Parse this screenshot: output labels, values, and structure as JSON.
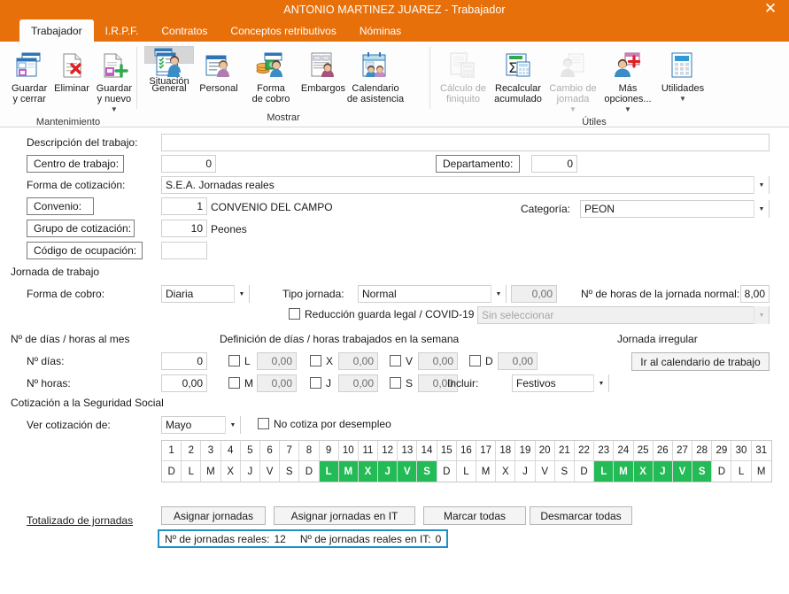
{
  "window": {
    "title": "ANTONIO MARTINEZ JUAREZ - Trabajador",
    "close_icon": "close-icon"
  },
  "tabs": [
    {
      "label": "Trabajador",
      "active": true
    },
    {
      "label": "I.R.P.F.",
      "active": false
    },
    {
      "label": "Contratos",
      "active": false
    },
    {
      "label": "Conceptos retributivos",
      "active": false
    },
    {
      "label": "Nóminas",
      "active": false
    }
  ],
  "ribbon": {
    "groups": [
      {
        "title": "Mantenimiento",
        "buttons": [
          {
            "label": "Guardar\ny cerrar",
            "icon": "save-close-icon",
            "disabled": false,
            "selected": false,
            "caret": false
          },
          {
            "label": "Eliminar",
            "icon": "delete-icon",
            "disabled": false,
            "selected": false,
            "caret": false
          },
          {
            "label": "Guardar\ny nuevo",
            "icon": "save-new-icon",
            "disabled": false,
            "selected": false,
            "caret": true
          }
        ]
      },
      {
        "title": "Mostrar",
        "buttons": [
          {
            "label": "General",
            "icon": "general-person-icon",
            "disabled": false,
            "selected": false,
            "caret": false
          },
          {
            "label": "Personal",
            "icon": "personal-icon",
            "disabled": false,
            "selected": false,
            "caret": false
          },
          {
            "label": "Situación",
            "icon": "situacion-icon",
            "disabled": false,
            "selected": true,
            "caret": false
          },
          {
            "label": "Forma\nde cobro",
            "icon": "forma-cobro-money-icon",
            "disabled": false,
            "selected": false,
            "caret": false
          },
          {
            "label": "Embargos",
            "icon": "embargos-icon",
            "disabled": false,
            "selected": false,
            "caret": false
          },
          {
            "label": "Calendario\nde asistencia",
            "icon": "calendar-asistencia-icon",
            "disabled": false,
            "selected": false,
            "caret": false
          }
        ]
      },
      {
        "title": "Útiles",
        "buttons": [
          {
            "label": "Cálculo de\nfiniquito",
            "icon": "calculo-finiquito-icon",
            "disabled": true,
            "selected": false,
            "caret": false
          },
          {
            "label": "Recalcular\nacumulado",
            "icon": "recalcular-sigma-icon",
            "disabled": false,
            "selected": false,
            "caret": false
          },
          {
            "label": "Cambio de\njornada",
            "icon": "cambio-jornada-icon",
            "disabled": true,
            "selected": false,
            "caret": true
          },
          {
            "label": "Más\nopciones...",
            "icon": "mas-opciones-icon",
            "disabled": false,
            "selected": false,
            "caret": true
          },
          {
            "label": "Utilidades",
            "icon": "utilidades-calculator-icon",
            "disabled": false,
            "selected": false,
            "caret": true
          }
        ]
      }
    ]
  },
  "form": {
    "descripcion_label": "Descripción del trabajo:",
    "descripcion_value": "",
    "centro_label": "Centro de trabajo:",
    "centro_value": "0",
    "departamento_label": "Departamento:",
    "departamento_value": "0",
    "forma_cotizacion_label": "Forma de cotización:",
    "forma_cotizacion_value": "S.E.A. Jornadas reales",
    "convenio_label": "Convenio:",
    "convenio_code": "1",
    "convenio_name": "CONVENIO DEL CAMPO",
    "categoria_label": "Categoría:",
    "categoria_value": "PEON",
    "grupo_label": "Grupo de cotización:",
    "grupo_code": "10",
    "grupo_name": "Peones",
    "codigo_ocupacion_label": "Código de ocupación:",
    "codigo_ocupacion_value": ""
  },
  "jornada": {
    "section_title": "Jornada de trabajo",
    "forma_cobro_label": "Forma de cobro:",
    "forma_cobro_value": "Diaria",
    "tipo_jornada_label": "Tipo jornada:",
    "tipo_jornada_value": "Normal",
    "tipo_jornada_num": "0,00",
    "horas_label": "Nº de horas de la jornada normal:",
    "horas_value": "8,00",
    "reduccion_label": "Reducción guarda legal / COVID-19",
    "reduccion_checked": false,
    "reduccion_value": "Sin seleccionar"
  },
  "dias_mes": {
    "section_title": "Nº de días / horas al mes",
    "dias_label": "Nº días:",
    "dias_value": "0",
    "horas_label": "Nº horas:",
    "horas_value": "0,00"
  },
  "semana": {
    "section_title": "Definición de días / horas trabajados en la semana",
    "days": [
      {
        "code": "L",
        "value": "0,00",
        "checked": false
      },
      {
        "code": "M",
        "value": "0,00",
        "checked": false
      },
      {
        "code": "X",
        "value": "0,00",
        "checked": false
      },
      {
        "code": "J",
        "value": "0,00",
        "checked": false
      },
      {
        "code": "V",
        "value": "0,00",
        "checked": false
      },
      {
        "code": "S",
        "value": "0,00",
        "checked": false
      },
      {
        "code": "D",
        "value": "0,00",
        "checked": false
      }
    ],
    "incluir_label": "Incluir:",
    "incluir_value": "Festivos"
  },
  "irregular": {
    "section_title": "Jornada irregular",
    "button_label": "Ir al calendario de trabajo"
  },
  "cotizacion": {
    "section_title": "Cotización a la Seguridad Social",
    "ver_label": "Ver cotización de:",
    "ver_value": "Mayo",
    "no_cotiza_label": "No cotiza por desempleo",
    "no_cotiza_checked": false
  },
  "calendar": {
    "days": [
      {
        "num": "1",
        "letter": "D",
        "on": false
      },
      {
        "num": "2",
        "letter": "L",
        "on": false
      },
      {
        "num": "3",
        "letter": "M",
        "on": false
      },
      {
        "num": "4",
        "letter": "X",
        "on": false
      },
      {
        "num": "5",
        "letter": "J",
        "on": false
      },
      {
        "num": "6",
        "letter": "V",
        "on": false
      },
      {
        "num": "7",
        "letter": "S",
        "on": false
      },
      {
        "num": "8",
        "letter": "D",
        "on": false
      },
      {
        "num": "9",
        "letter": "L",
        "on": true
      },
      {
        "num": "10",
        "letter": "M",
        "on": true
      },
      {
        "num": "11",
        "letter": "X",
        "on": true
      },
      {
        "num": "12",
        "letter": "J",
        "on": true
      },
      {
        "num": "13",
        "letter": "V",
        "on": true
      },
      {
        "num": "14",
        "letter": "S",
        "on": true
      },
      {
        "num": "15",
        "letter": "D",
        "on": false
      },
      {
        "num": "16",
        "letter": "L",
        "on": false
      },
      {
        "num": "17",
        "letter": "M",
        "on": false
      },
      {
        "num": "18",
        "letter": "X",
        "on": false
      },
      {
        "num": "19",
        "letter": "J",
        "on": false
      },
      {
        "num": "20",
        "letter": "V",
        "on": false
      },
      {
        "num": "21",
        "letter": "S",
        "on": false
      },
      {
        "num": "22",
        "letter": "D",
        "on": false
      },
      {
        "num": "23",
        "letter": "L",
        "on": true
      },
      {
        "num": "24",
        "letter": "M",
        "on": true
      },
      {
        "num": "25",
        "letter": "X",
        "on": true
      },
      {
        "num": "26",
        "letter": "J",
        "on": true
      },
      {
        "num": "27",
        "letter": "V",
        "on": true
      },
      {
        "num": "28",
        "letter": "S",
        "on": true
      },
      {
        "num": "29",
        "letter": "D",
        "on": false
      },
      {
        "num": "30",
        "letter": "L",
        "on": false
      },
      {
        "num": "31",
        "letter": "M",
        "on": false
      }
    ],
    "selected_color": "#22BB55"
  },
  "totales": {
    "label": "Totalizado de jornadas",
    "buttons": [
      "Asignar jornadas",
      "Asignar jornadas en IT",
      "Marcar todas",
      "Desmarcar todas"
    ],
    "reales_label": "Nº de jornadas reales:",
    "reales_value": "12",
    "reales_it_label": "Nº de jornadas reales en IT:",
    "reales_it_value": "0",
    "highlight_color": "#1E90C8"
  }
}
